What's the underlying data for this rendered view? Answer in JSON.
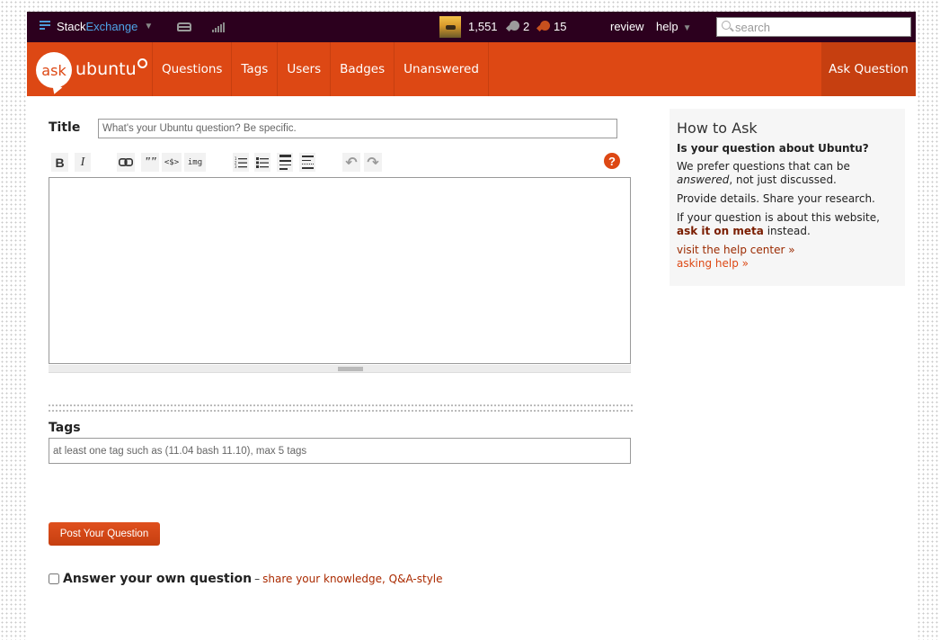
{
  "topbar": {
    "brand_part1": "Stack",
    "brand_part2": "Exchange",
    "brand_caret": "▼",
    "inbox_icon": "inbox-icon",
    "achievements_icon": "achievements-icon",
    "reputation": "1,551",
    "silver_badges": "2",
    "bronze_badges": "15",
    "review": "review",
    "help": "help",
    "help_caret": "▼",
    "search_placeholder": "search"
  },
  "header": {
    "logo_ask": "ask",
    "logo_word": "ubuntu",
    "nav": [
      "Questions",
      "Tags",
      "Users",
      "Badges",
      "Unanswered"
    ],
    "ask_question": "Ask Question",
    "colors": {
      "brand": "#dd4814",
      "topbar": "#2c001e"
    }
  },
  "form": {
    "title_label": "Title",
    "title_placeholder": "What's your Ubuntu question? Be specific.",
    "title_value": "",
    "toolbar": {
      "bold": "B",
      "italic": "I",
      "quote": "\"\"",
      "code": "<$>",
      "image": "img",
      "undo": "↶",
      "redo": "↷",
      "help": "?"
    },
    "body_value": "",
    "tags_label": "Tags",
    "tags_placeholder": "at least one tag such as (11.04 bash 11.10), max 5 tags",
    "tags_value": "",
    "post_button": "Post Your Question",
    "answer_own_label": "Answer your own question",
    "answer_own_dash": "–",
    "answer_own_sub": "share your knowledge, Q&A-style",
    "answer_own_checked": false
  },
  "sidebar": {
    "title": "How to Ask",
    "question": "Is your question about Ubuntu?",
    "prefer_1": "We prefer questions that can be",
    "prefer_em": "answered",
    "prefer_2": ", not just discussed.",
    "details": "Provide details. Share your research.",
    "website_1": "If your question is about this website,",
    "meta_link": "ask it on meta",
    "website_2": " instead.",
    "help_center": "visit the help center »",
    "asking_help": "asking help »"
  }
}
